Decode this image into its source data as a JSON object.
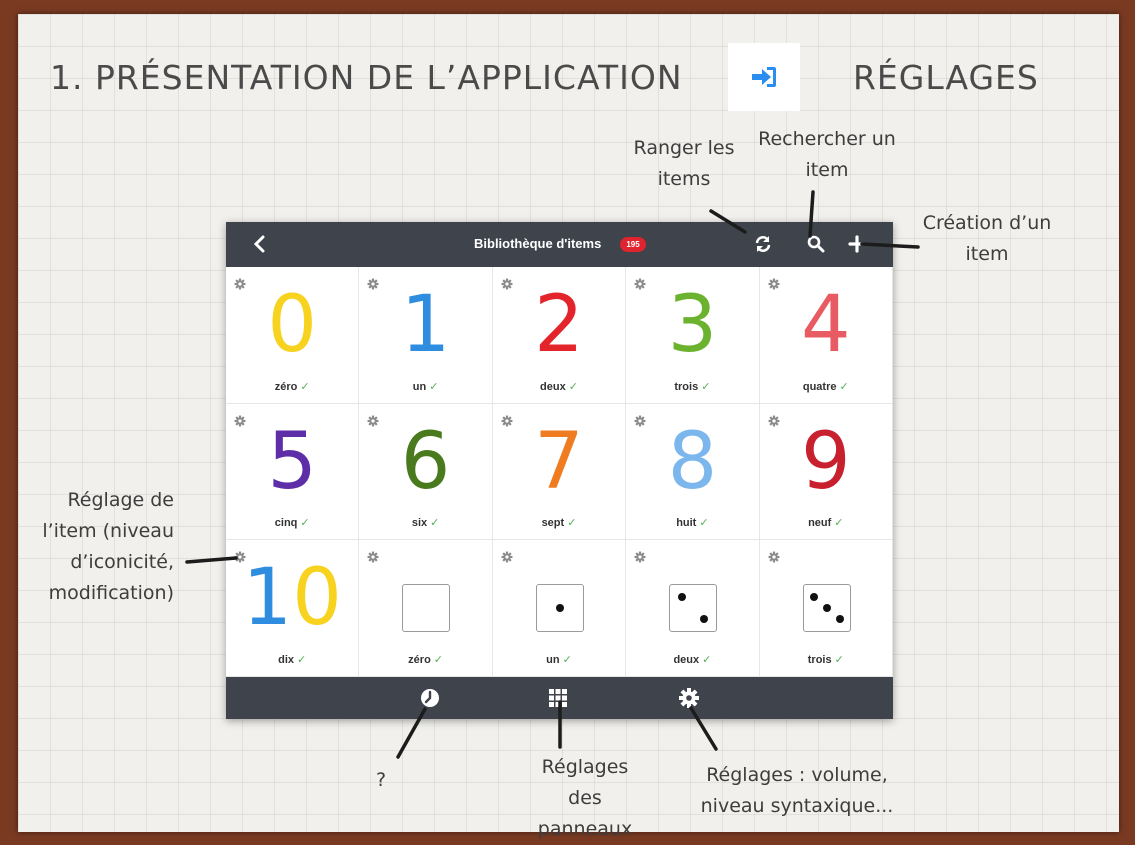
{
  "slide": {
    "title_left": "1. PRÉSENTATION DE L’APPLICATION",
    "title_right": "RÉGLAGES",
    "login_icon": "sign-in-icon"
  },
  "annotations": {
    "ranger_line1": "Ranger les",
    "ranger_line2": "items",
    "rechercher_line1": "Rechercher un",
    "rechercher_line2": "item",
    "creation_line1": "Création d’un",
    "creation_line2": "item",
    "reglage_item_line1": "Réglage de",
    "reglage_item_line2": "l’item (niveau",
    "reglage_item_line3": "d’iconicité,",
    "reglage_item_line4": "modification)",
    "question": "?",
    "panneaux_line1": "Réglages",
    "panneaux_line2": "des panneaux",
    "volume_line1": "Réglages : volume,",
    "volume_line2": "niveau syntaxique..."
  },
  "app": {
    "header_title": "Bibliothèque d'items",
    "badge_count": "195",
    "icons": {
      "back": "chevron-left-icon",
      "sort": "refresh-icon",
      "search": "search-icon",
      "add": "plus-icon"
    },
    "items": [
      {
        "glyph": "0",
        "label": "zéro",
        "color": "#f7d21e"
      },
      {
        "glyph": "1",
        "label": "un",
        "color": "#2f8de0"
      },
      {
        "glyph": "2",
        "label": "deux",
        "color": "#e3242b"
      },
      {
        "glyph": "3",
        "label": "trois",
        "color": "#6bb32e"
      },
      {
        "glyph": "4",
        "label": "quatre",
        "color": "#e85b62"
      },
      {
        "glyph": "5",
        "label": "cinq",
        "color": "#5d2ea8"
      },
      {
        "glyph": "6",
        "label": "six",
        "color": "#4a7a1e"
      },
      {
        "glyph": "7",
        "label": "sept",
        "color": "#f07c22"
      },
      {
        "glyph": "8",
        "label": "huit",
        "color": "#7bb6ec"
      },
      {
        "glyph": "9",
        "label": "neuf",
        "color": "#c9202f"
      },
      {
        "glyph": "10",
        "label": "dix",
        "color": "#2f8de0"
      },
      {
        "dice": 0,
        "label": "zéro"
      },
      {
        "dice": 1,
        "label": "un"
      },
      {
        "dice": 2,
        "label": "deux"
      },
      {
        "dice": 3,
        "label": "trois"
      }
    ],
    "checkmark": "✓",
    "bottom_icons": {
      "help": "clock-icon",
      "panels": "grid-icon",
      "settings": "gear-icon"
    }
  }
}
